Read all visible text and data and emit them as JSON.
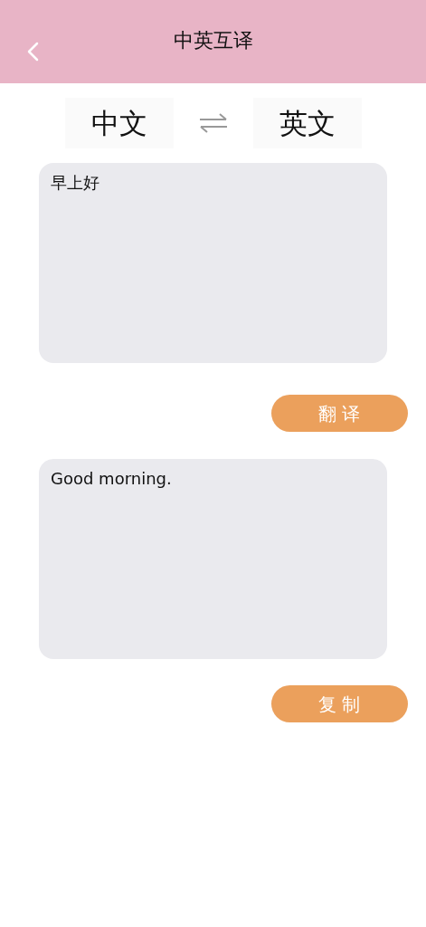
{
  "header": {
    "title": "中英互译"
  },
  "languages": {
    "source": "中文",
    "target": "英文"
  },
  "input": {
    "value": "早上好"
  },
  "translate_button": "翻 译",
  "output": {
    "text": "Good morning."
  },
  "copy_button": "复 制"
}
